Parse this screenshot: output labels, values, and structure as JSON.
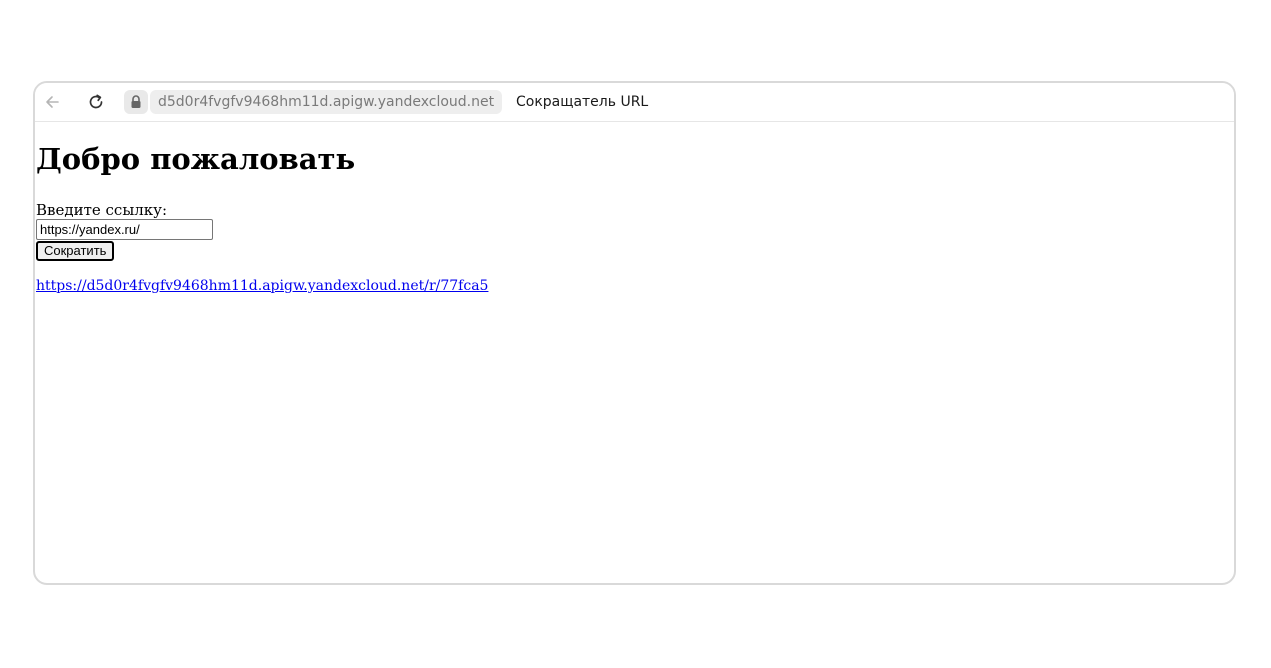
{
  "toolbar": {
    "back_icon": "back-arrow-icon",
    "reload_icon": "reload-icon",
    "lock_icon": "lock-icon",
    "address": "d5d0r4fvgfv9468hm11d.apigw.yandexcloud.net",
    "tab_title": "Сокращатель URL"
  },
  "page": {
    "heading": "Добро пожаловать",
    "input_label": "Введите ссылку:",
    "input_value": "https://yandex.ru/",
    "button_label": "Сократить",
    "result_link": "https://d5d0r4fvgfv9468hm11d.apigw.yandexcloud.net/r/77fca5"
  },
  "colors": {
    "link": "#0000ee",
    "window_border": "#d9d9d9",
    "address_bg": "#eeeeee"
  }
}
